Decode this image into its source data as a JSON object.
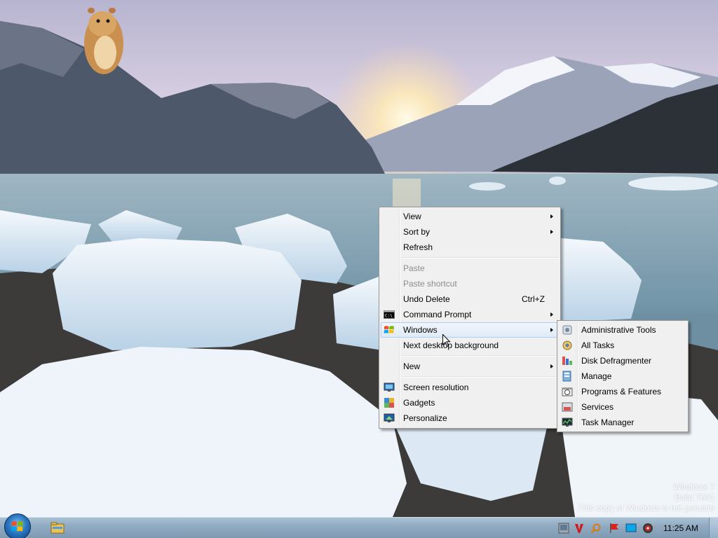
{
  "desktop": {
    "context_menu": {
      "items": [
        {
          "label": "View",
          "submenu": true,
          "disabled": false
        },
        {
          "label": "Sort by",
          "submenu": true,
          "disabled": false
        },
        {
          "label": "Refresh",
          "submenu": false,
          "disabled": false
        },
        {
          "separator": true
        },
        {
          "label": "Paste",
          "submenu": false,
          "disabled": true
        },
        {
          "label": "Paste shortcut",
          "submenu": false,
          "disabled": true
        },
        {
          "label": "Undo Delete",
          "shortcut": "Ctrl+Z",
          "submenu": false,
          "disabled": false
        },
        {
          "label": "Command Prompt",
          "submenu": true,
          "disabled": false,
          "icon": "command-prompt-icon"
        },
        {
          "label": "Windows",
          "submenu": true,
          "disabled": false,
          "icon": "windows-logo-icon",
          "highlighted": true
        },
        {
          "label": "Next desktop background",
          "submenu": false,
          "disabled": false
        },
        {
          "separator": true
        },
        {
          "label": "New",
          "submenu": true,
          "disabled": false
        },
        {
          "separator": true
        },
        {
          "label": "Screen resolution",
          "submenu": false,
          "disabled": false,
          "icon": "screen-resolution-icon"
        },
        {
          "label": "Gadgets",
          "submenu": false,
          "disabled": false,
          "icon": "gadgets-icon"
        },
        {
          "label": "Personalize",
          "submenu": false,
          "disabled": false,
          "icon": "personalize-icon"
        }
      ]
    },
    "windows_submenu": {
      "items": [
        {
          "label": "Administrative Tools",
          "icon": "administrative-tools-icon"
        },
        {
          "label": "All Tasks",
          "icon": "all-tasks-icon"
        },
        {
          "label": "Disk Defragmenter",
          "icon": "disk-defragmenter-icon"
        },
        {
          "label": "Manage",
          "icon": "manage-icon"
        },
        {
          "label": "Programs & Features",
          "icon": "programs-features-icon"
        },
        {
          "label": "Services",
          "icon": "services-icon"
        },
        {
          "label": "Task Manager",
          "icon": "task-manager-icon"
        }
      ]
    },
    "watermark": {
      "line1": "Windows 7",
      "line2": "Build 7601",
      "line3": "This copy of Windows is not genuine"
    }
  },
  "taskbar": {
    "start_button": "start-orb-icon",
    "pinned": [
      {
        "icon": "windows-explorer-icon"
      }
    ],
    "tray": [
      {
        "icon": "network-icon"
      },
      {
        "icon": "antivirus-icon"
      },
      {
        "icon": "search-icon"
      },
      {
        "icon": "action-center-flag-icon"
      },
      {
        "icon": "display-icon"
      },
      {
        "icon": "volume-icon"
      }
    ],
    "clock": "11:25 AM"
  },
  "colors": {
    "menu_background": "#f0f0f0",
    "menu_border": "#979797",
    "menu_highlight": "#dfeaf7",
    "disabled_text": "#8d8d8d",
    "taskbar": "#8ea9c0"
  }
}
